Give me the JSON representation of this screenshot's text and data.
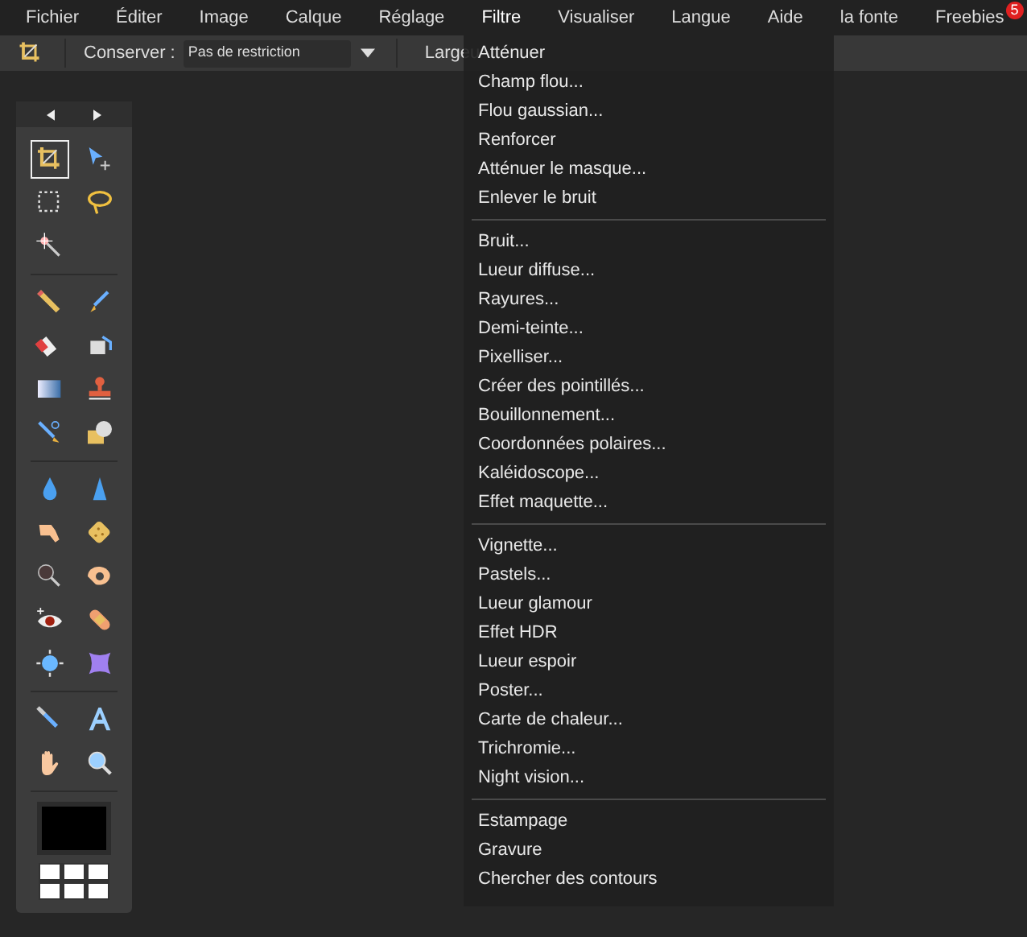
{
  "menu_bar": [
    {
      "label": "Fichier",
      "selected": false
    },
    {
      "label": "Éditer",
      "selected": false
    },
    {
      "label": "Image",
      "selected": false
    },
    {
      "label": "Calque",
      "selected": false
    },
    {
      "label": "Réglage",
      "selected": false
    },
    {
      "label": "Filtre",
      "selected": true
    },
    {
      "label": "Visualiser",
      "selected": false
    },
    {
      "label": "Langue",
      "selected": false
    },
    {
      "label": "Aide",
      "selected": false
    },
    {
      "label": "la fonte",
      "selected": false
    },
    {
      "label": "Freebies",
      "selected": false,
      "badge": "5"
    }
  ],
  "options_bar": {
    "keep_label": "Conserver :",
    "keep_value": "Pas de restriction",
    "width_label": "Largeu"
  },
  "tool_groups": [
    [
      {
        "selected": true
      },
      {
        "selected": false
      },
      {
        "selected": false
      },
      {
        "selected": false
      },
      {
        "selected": false
      }
    ],
    [
      {
        "selected": false
      },
      {
        "selected": false
      },
      {
        "selected": false
      },
      {
        "selected": false
      },
      {
        "selected": false
      },
      {
        "selected": false
      },
      {
        "selected": false
      },
      {
        "selected": false
      }
    ],
    [
      {
        "selected": false
      },
      {
        "selected": false
      },
      {
        "selected": false
      },
      {
        "selected": false
      },
      {
        "selected": false
      },
      {
        "selected": false
      },
      {
        "selected": false
      },
      {
        "selected": false
      },
      {
        "selected": false
      },
      {
        "selected": false
      }
    ],
    [
      {
        "selected": false
      },
      {
        "selected": false
      },
      {
        "selected": false
      },
      {
        "selected": false
      }
    ]
  ],
  "filter_menu": [
    [
      "Atténuer",
      "Champ flou...",
      "Flou gaussian...",
      "Renforcer",
      "Atténuer le masque...",
      "Enlever le bruit"
    ],
    [
      "Bruit...",
      "Lueur diffuse...",
      "Rayures...",
      "Demi-teinte...",
      "Pixelliser...",
      "Créer des pointillés...",
      "Bouillonnement...",
      "Coordonnées polaires...",
      "Kaléidoscope...",
      "Effet maquette..."
    ],
    [
      "Vignette...",
      "Pastels...",
      "Lueur glamour",
      "Effet HDR",
      "Lueur espoir",
      "Poster...",
      "Carte de chaleur...",
      "Trichromie...",
      "Night vision..."
    ],
    [
      "Estampage",
      "Gravure",
      "Chercher des contours"
    ]
  ]
}
